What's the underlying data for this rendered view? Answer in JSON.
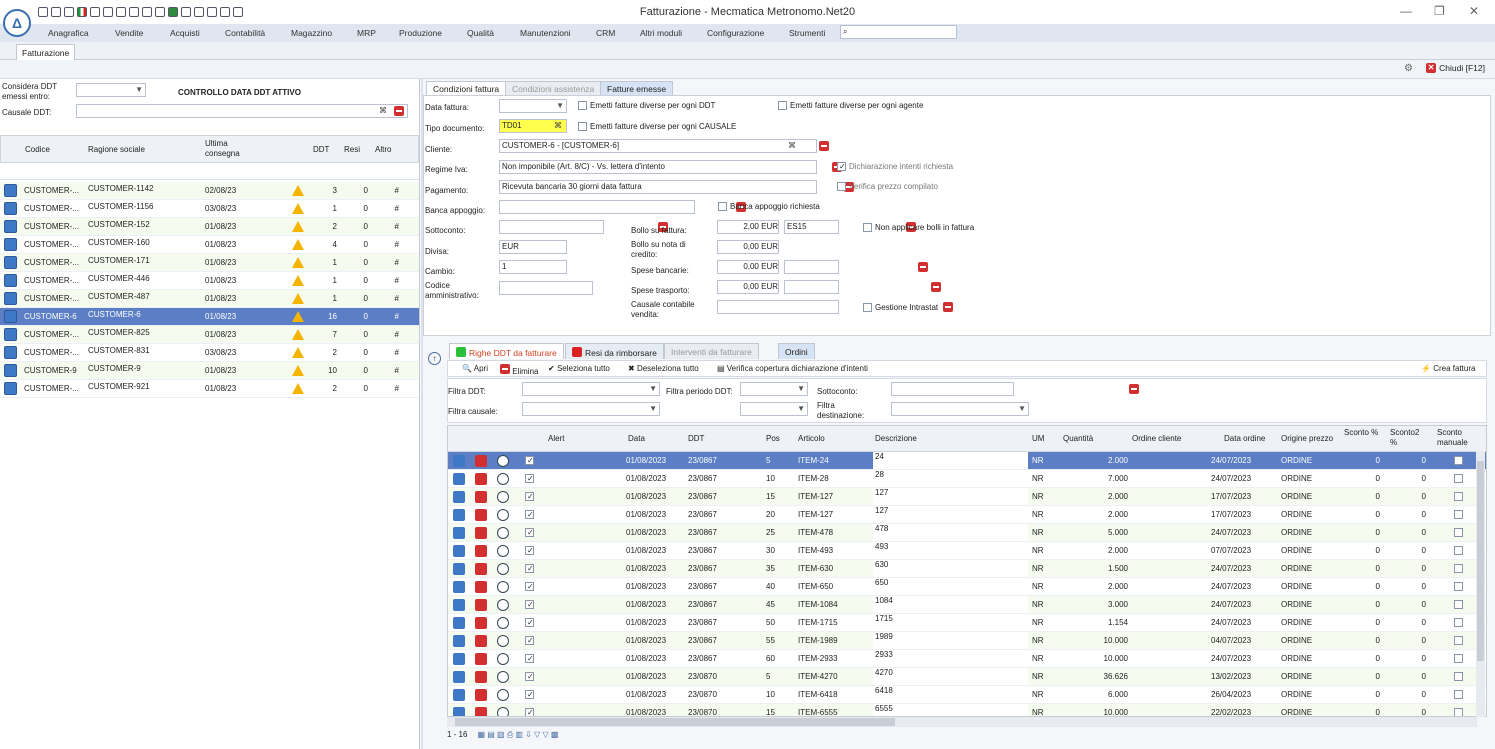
{
  "window": {
    "title": "Fatturazione - Mecmatica Metronomo.Net20"
  },
  "menu": [
    "Anagrafica",
    "Vendite",
    "Acquisti",
    "Contabilità",
    "Magazzino",
    "MRP",
    "Produzione",
    "Qualità",
    "Manutenzioni",
    "CRM",
    "Altri moduli",
    "Configurazione",
    "Strumenti"
  ],
  "doc_tab": "Fatturazione",
  "close_label": "Chiudi [F12]",
  "left": {
    "considera_label": "Considera DDT emessi entro:",
    "controllo": "CONTROLLO DATA DDT ATTIVO",
    "causale_label": "Causale DDT:",
    "headers": [
      "Codice",
      "Ragione sociale",
      "Ultima consegna",
      "DDT",
      "Resi",
      "Altro"
    ],
    "rows": [
      {
        "codice": "CUSTOMER-...",
        "ragione": "CUSTOMER-1142",
        "data": "02/08/23",
        "ddt": "3",
        "resi": "0",
        "altro": "#"
      },
      {
        "codice": "CUSTOMER-...",
        "ragione": "CUSTOMER-1156",
        "data": "03/08/23",
        "ddt": "1",
        "resi": "0",
        "altro": "#"
      },
      {
        "codice": "CUSTOMER-...",
        "ragione": "CUSTOMER-152",
        "data": "01/08/23",
        "ddt": "2",
        "resi": "0",
        "altro": "#"
      },
      {
        "codice": "CUSTOMER-...",
        "ragione": "CUSTOMER-160",
        "data": "01/08/23",
        "ddt": "4",
        "resi": "0",
        "altro": "#"
      },
      {
        "codice": "CUSTOMER-...",
        "ragione": "CUSTOMER-171",
        "data": "01/08/23",
        "ddt": "1",
        "resi": "0",
        "altro": "#"
      },
      {
        "codice": "CUSTOMER-...",
        "ragione": "CUSTOMER-446",
        "data": "01/08/23",
        "ddt": "1",
        "resi": "0",
        "altro": "#"
      },
      {
        "codice": "CUSTOMER-...",
        "ragione": "CUSTOMER-487",
        "data": "01/08/23",
        "ddt": "1",
        "resi": "0",
        "altro": "#"
      },
      {
        "codice": "CUSTOMER-6",
        "ragione": "CUSTOMER-6",
        "data": "01/08/23",
        "ddt": "16",
        "resi": "0",
        "altro": "#"
      },
      {
        "codice": "CUSTOMER-...",
        "ragione": "CUSTOMER-825",
        "data": "01/08/23",
        "ddt": "7",
        "resi": "0",
        "altro": "#"
      },
      {
        "codice": "CUSTOMER-...",
        "ragione": "CUSTOMER-831",
        "data": "03/08/23",
        "ddt": "2",
        "resi": "0",
        "altro": "#"
      },
      {
        "codice": "CUSTOMER-9",
        "ragione": "CUSTOMER-9",
        "data": "01/08/23",
        "ddt": "10",
        "resi": "0",
        "altro": "#"
      },
      {
        "codice": "CUSTOMER-...",
        "ragione": "CUSTOMER-921",
        "data": "01/08/23",
        "ddt": "2",
        "resi": "0",
        "altro": "#"
      }
    ]
  },
  "right_tabs": [
    "Condizioni fattura",
    "Condizioni assistenza",
    "Fatture emesse"
  ],
  "form": {
    "data_fattura": "Data fattura:",
    "tipo_doc": "Tipo documento:",
    "tipo_doc_val": "TD01",
    "cliente": "Cliente:",
    "cliente_val": "CUSTOMER-6 - [CUSTOMER-6]",
    "regime": "Regime Iva:",
    "regime_val": "Non imponibile (Art. 8/C) - Vs. lettera d'intento",
    "pagamento": "Pagamento:",
    "pagamento_val": "Ricevuta bancaria 30 giorni data fattura",
    "banca": "Banca appoggio:",
    "sottoconto": "Sottoconto:",
    "divisa": "Divisa:",
    "divisa_val": "EUR",
    "cambio": "Cambio:",
    "cambio_val": "1",
    "codice_amm": "Codice amministrativo:",
    "chk_ddt": "Emetti fatture diverse per ogni DDT",
    "chk_agente": "Emetti fatture diverse per ogni agente",
    "chk_causale": "Emetti fatture diverse per ogni CAUSALE",
    "chk_intenti": "Dichiarazione intenti richiesta",
    "chk_prezzo": "Verifica prezzo compilato",
    "chk_banca": "Banca appoggio richiesta",
    "bollo_fattura": "Bollo su fattura:",
    "bollo_fattura_val": "2,00 EUR",
    "bollo_code": "ES15",
    "bollo_nota": "Bollo su nota di credito:",
    "bollo_nota_val": "0,00 EUR",
    "spese_banc": "Spese bancarie:",
    "spese_banc_val": "0,00 EUR",
    "spese_tr": "Spese trasporto:",
    "spese_tr_val": "0,00 EUR",
    "causale_cont": "Causale contabile vendita:",
    "chk_bolli": "Non applicare bolli in fattura",
    "chk_intrastat": "Gestione Intrastat"
  },
  "bottom_tabs": [
    "Righe DDT da fatturare",
    "Resi da rimborsare",
    "Interventi da fatturare",
    "Ordini"
  ],
  "actions": {
    "apri": "Apri",
    "elimina": "Elimina",
    "sel": "Seleziona tutto",
    "desel": "Deseleziona tutto",
    "verifica": "Verifica copertura dichiarazione d'intenti",
    "crea": "Crea fattura"
  },
  "filters": {
    "ddt": "Filtra DDT:",
    "periodo": "Filtra periodo DDT:",
    "sottoconto": "Sottoconto:",
    "causale": "Filtra causale:",
    "dest": "Filtra destinazione:"
  },
  "grid_headers": [
    "Alert",
    "Data",
    "DDT",
    "Pos",
    "Articolo",
    "Descrizione",
    "UM",
    "Quantità",
    "Ordine cliente",
    "Data ordine",
    "Origine prezzo",
    "Sconto %",
    "Sconto2 %",
    "Sconto manuale"
  ],
  "rows": [
    {
      "data": "01/08/2023",
      "ddt": "23/0867",
      "pos": "5",
      "art": "ITEM-24",
      "desc": "24",
      "um": "NR",
      "qta": "2.000",
      "dord": "24/07/2023",
      "orig": "ORDINE",
      "s1": "0",
      "s2": "0"
    },
    {
      "data": "01/08/2023",
      "ddt": "23/0867",
      "pos": "10",
      "art": "ITEM-28",
      "desc": "28",
      "um": "NR",
      "qta": "7.000",
      "dord": "24/07/2023",
      "orig": "ORDINE",
      "s1": "0",
      "s2": "0"
    },
    {
      "data": "01/08/2023",
      "ddt": "23/0867",
      "pos": "15",
      "art": "ITEM-127",
      "desc": "127",
      "um": "NR",
      "qta": "2.000",
      "dord": "17/07/2023",
      "orig": "ORDINE",
      "s1": "0",
      "s2": "0"
    },
    {
      "data": "01/08/2023",
      "ddt": "23/0867",
      "pos": "20",
      "art": "ITEM-127",
      "desc": "127",
      "um": "NR",
      "qta": "2.000",
      "dord": "17/07/2023",
      "orig": "ORDINE",
      "s1": "0",
      "s2": "0"
    },
    {
      "data": "01/08/2023",
      "ddt": "23/0867",
      "pos": "25",
      "art": "ITEM-478",
      "desc": "478",
      "um": "NR",
      "qta": "5.000",
      "dord": "24/07/2023",
      "orig": "ORDINE",
      "s1": "0",
      "s2": "0"
    },
    {
      "data": "01/08/2023",
      "ddt": "23/0867",
      "pos": "30",
      "art": "ITEM-493",
      "desc": "493",
      "um": "NR",
      "qta": "2.000",
      "dord": "07/07/2023",
      "orig": "ORDINE",
      "s1": "0",
      "s2": "0"
    },
    {
      "data": "01/08/2023",
      "ddt": "23/0867",
      "pos": "35",
      "art": "ITEM-630",
      "desc": "630",
      "um": "NR",
      "qta": "1.500",
      "dord": "24/07/2023",
      "orig": "ORDINE",
      "s1": "0",
      "s2": "0"
    },
    {
      "data": "01/08/2023",
      "ddt": "23/0867",
      "pos": "40",
      "art": "ITEM-650",
      "desc": "650",
      "um": "NR",
      "qta": "2.000",
      "dord": "24/07/2023",
      "orig": "ORDINE",
      "s1": "0",
      "s2": "0"
    },
    {
      "data": "01/08/2023",
      "ddt": "23/0867",
      "pos": "45",
      "art": "ITEM-1084",
      "desc": "1084",
      "um": "NR",
      "qta": "3.000",
      "dord": "24/07/2023",
      "orig": "ORDINE",
      "s1": "0",
      "s2": "0"
    },
    {
      "data": "01/08/2023",
      "ddt": "23/0867",
      "pos": "50",
      "art": "ITEM-1715",
      "desc": "1715",
      "um": "NR",
      "qta": "1.154",
      "dord": "24/07/2023",
      "orig": "ORDINE",
      "s1": "0",
      "s2": "0"
    },
    {
      "data": "01/08/2023",
      "ddt": "23/0867",
      "pos": "55",
      "art": "ITEM-1989",
      "desc": "1989",
      "um": "NR",
      "qta": "10.000",
      "dord": "04/07/2023",
      "orig": "ORDINE",
      "s1": "0",
      "s2": "0"
    },
    {
      "data": "01/08/2023",
      "ddt": "23/0867",
      "pos": "60",
      "art": "ITEM-2933",
      "desc": "2933",
      "um": "NR",
      "qta": "10.000",
      "dord": "24/07/2023",
      "orig": "ORDINE",
      "s1": "0",
      "s2": "0"
    },
    {
      "data": "01/08/2023",
      "ddt": "23/0870",
      "pos": "5",
      "art": "ITEM-4270",
      "desc": "4270",
      "um": "NR",
      "qta": "36.626",
      "dord": "13/02/2023",
      "orig": "ORDINE",
      "s1": "0",
      "s2": "0"
    },
    {
      "data": "01/08/2023",
      "ddt": "23/0870",
      "pos": "10",
      "art": "ITEM-6418",
      "desc": "6418",
      "um": "NR",
      "qta": "6.000",
      "dord": "26/04/2023",
      "orig": "ORDINE",
      "s1": "0",
      "s2": "0"
    },
    {
      "data": "01/08/2023",
      "ddt": "23/0870",
      "pos": "15",
      "art": "ITEM-6555",
      "desc": "6555",
      "um": "NR",
      "qta": "10.000",
      "dord": "22/02/2023",
      "orig": "ORDINE",
      "s1": "0",
      "s2": "0"
    }
  ],
  "pager": "1 - 16"
}
